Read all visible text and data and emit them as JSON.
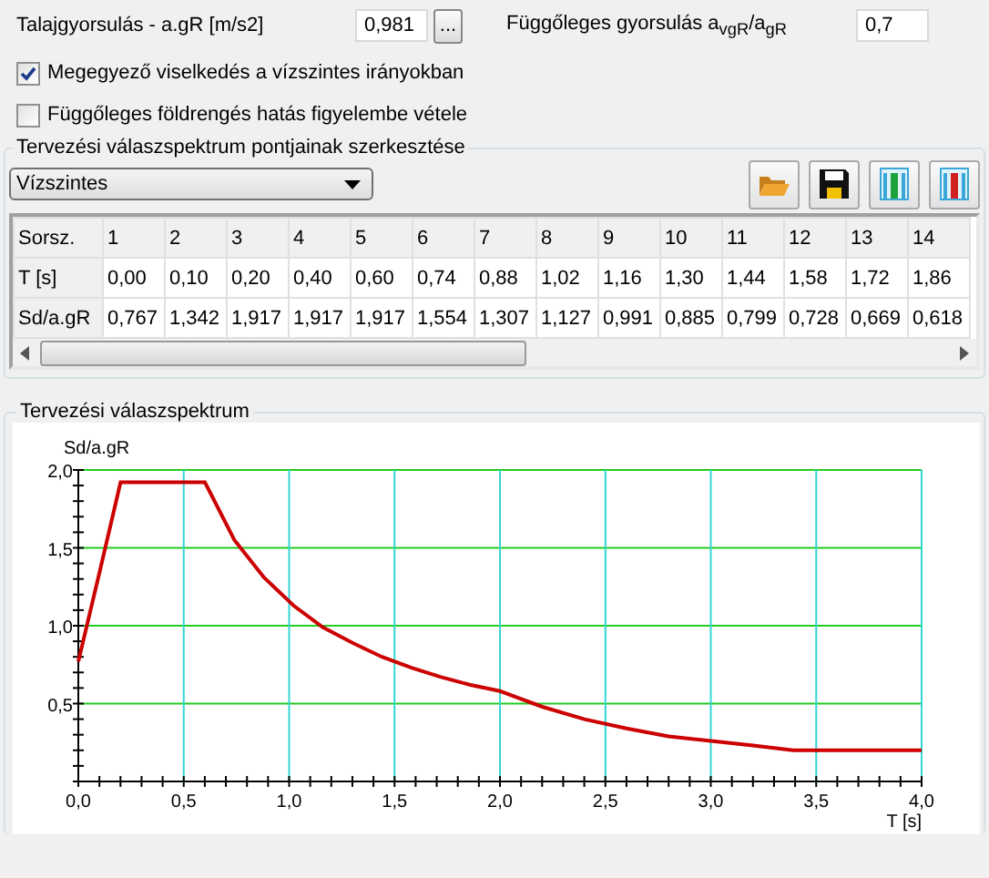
{
  "ground_accel": {
    "label": "Talajgyorsulás - a.gR [m/s2]",
    "value": "0,981",
    "button": "..."
  },
  "vertical_ratio": {
    "label": "Függőleges gyorsulás a$_{vgR}$/a$_{gR}$",
    "value": "0,7"
  },
  "checkboxes": [
    {
      "label": "Megegyező viselkedés a vízszintes irányokban",
      "checked": true
    },
    {
      "label": "Függőleges földrengés hatás figyelembe vétele",
      "checked": false
    }
  ],
  "editor": {
    "title": "Tervezési válaszspektrum pontjainak szerkesztése",
    "dropdown": "Vízszintes",
    "table": {
      "rows": [
        {
          "header": "Sorsz.",
          "cells": [
            "1",
            "2",
            "3",
            "4",
            "5",
            "6",
            "7",
            "8",
            "9",
            "10",
            "11",
            "12",
            "13",
            "14"
          ]
        },
        {
          "header": "T [s]",
          "cells": [
            "0,00",
            "0,10",
            "0,20",
            "0,40",
            "0,60",
            "0,74",
            "0,88",
            "1,02",
            "1,16",
            "1,30",
            "1,44",
            "1,58",
            "1,72",
            "1,86"
          ]
        },
        {
          "header": "Sd/a.gR",
          "cells": [
            "0,767",
            "1,342",
            "1,917",
            "1,917",
            "1,917",
            "1,554",
            "1,307",
            "1,127",
            "0,991",
            "0,885",
            "0,799",
            "0,728",
            "0,669",
            "0,618"
          ]
        }
      ]
    }
  },
  "chart_panel": {
    "title": "Tervezési válaszspektrum",
    "chart_data": {
      "type": "line",
      "grid": true,
      "xlabel": "T [s]",
      "ylabel": "Sd/a.gR",
      "xlim": [
        0,
        4
      ],
      "ylim": [
        0,
        2
      ],
      "xticks": [
        {
          "value": 0,
          "label": "0,0"
        },
        {
          "value": 0.5,
          "label": "0,5"
        },
        {
          "value": 1,
          "label": "1,0"
        },
        {
          "value": 1.5,
          "label": "1,5"
        },
        {
          "value": 2,
          "label": "2,0"
        },
        {
          "value": 2.5,
          "label": "2,5"
        },
        {
          "value": 3,
          "label": "3,0"
        },
        {
          "value": 3.5,
          "label": "3,5"
        },
        {
          "value": 4,
          "label": "4,0"
        }
      ],
      "yticks": [
        {
          "value": 0.5,
          "label": "0,5"
        },
        {
          "value": 1,
          "label": "1,0"
        },
        {
          "value": 1.5,
          "label": "1,5"
        },
        {
          "value": 2,
          "label": "2,0"
        }
      ],
      "x": [
        0,
        0.1,
        0.2,
        0.4,
        0.6,
        0.74,
        0.88,
        1.02,
        1.16,
        1.3,
        1.44,
        1.58,
        1.72,
        1.86,
        2.0,
        2.2,
        2.4,
        2.6,
        2.8,
        3.0,
        3.2,
        3.39,
        4.0
      ],
      "series": [
        {
          "color": "#cc0000",
          "values": [
            0.77,
            1.34,
            1.92,
            1.92,
            1.92,
            1.55,
            1.31,
            1.13,
            0.99,
            0.89,
            0.8,
            0.73,
            0.67,
            0.62,
            0.58,
            0.48,
            0.4,
            0.34,
            0.29,
            0.26,
            0.23,
            0.2,
            0.2
          ]
        }
      ]
    }
  }
}
